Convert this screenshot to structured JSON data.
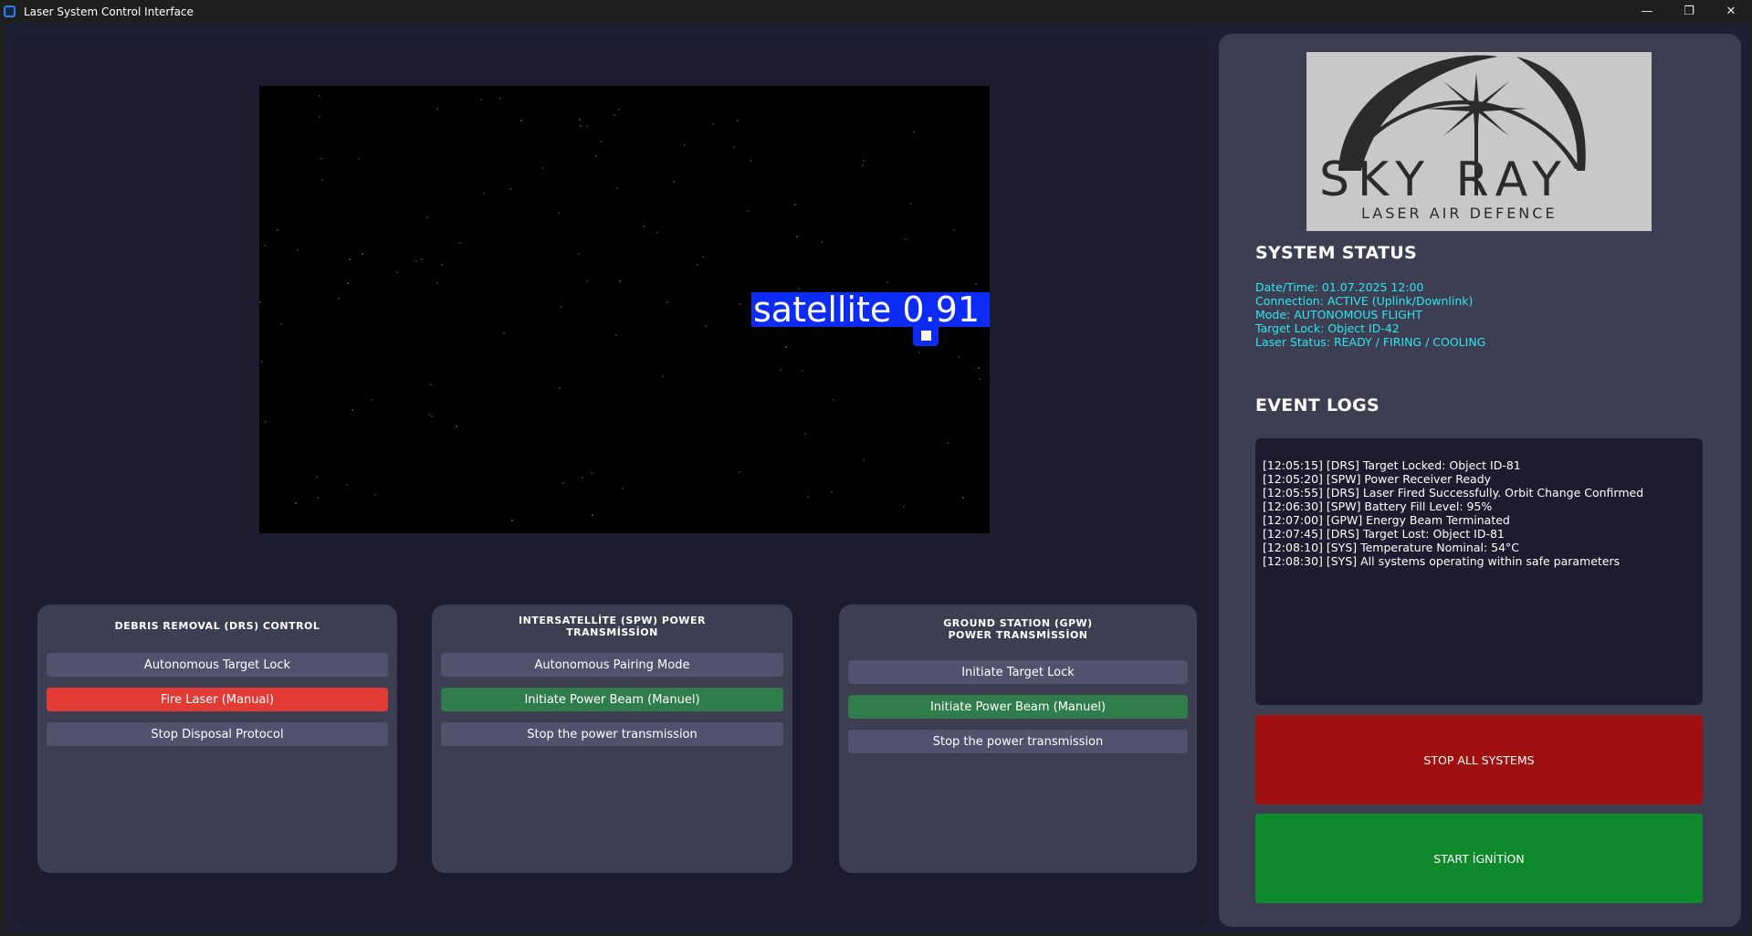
{
  "window": {
    "title": "Laser System Control Interface",
    "controls": {
      "minimize": "—",
      "maximize": "❐",
      "close": "✕"
    }
  },
  "camera": {
    "detection_label": "satellite 0.91"
  },
  "panels": [
    {
      "title": "DEBRIS REMOVAL (DRS) CONTROL",
      "buttons": [
        "Autonomous Target Lock",
        "Fire Laser (Manual)",
        "Stop Disposal Protocol"
      ]
    },
    {
      "title_line1": "INTERSATELLİTE (SPW) POWER",
      "title_line2": "TRANSMİSSİON",
      "buttons": [
        "Autonomous Pairing Mode",
        "Initiate Power Beam (Manuel)",
        "Stop the power transmission"
      ]
    },
    {
      "title_line1": "GROUND STATION (GPW)",
      "title_line2": "POWER TRANSMİSSİON",
      "buttons": [
        "Initiate Target Lock",
        "Initiate Power Beam (Manuel)",
        "Stop the power transmission"
      ]
    }
  ],
  "logo": {
    "brand": "SKY RAY",
    "tagline": "LASER AIR DEFENCE"
  },
  "system_status": {
    "title": "SYSTEM STATUS",
    "lines": [
      "Date/Time: 01.07.2025 12:00",
      "Connection: ACTIVE (Uplink/Downlink)",
      "Mode: AUTONOMOUS FLIGHT",
      "Target Lock: Object ID-42",
      "Laser Status: READY / FIRING / COOLING"
    ]
  },
  "event_logs": {
    "title": "EVENT LOGS",
    "entries": [
      "[12:05:15] [DRS] Target Locked: Object ID-81",
      "[12:05:20] [SPW] Power Receiver Ready",
      "[12:05:55] [DRS] Laser Fired Successfully. Orbit Change Confirmed",
      "[12:06:30] [SPW] Battery Fill Level: 95%",
      "[12:07:00] [GPW] Energy Beam Terminated",
      "[12:07:45] [DRS] Target Lost: Object ID-81",
      "[12:08:10] [SYS] Temperature Nominal: 54°C",
      "[12:08:30] [SYS] All systems operating within safe parameters"
    ]
  },
  "actions": {
    "stop_all": "STOP ALL SYSTEMS",
    "start_ignition": "START İGNİTİON"
  },
  "colors": {
    "accent_cyan": "#2de6f0",
    "fire_red": "#e23a35",
    "beam_green": "#2e7d4a",
    "stop_red": "#a01010",
    "start_green": "#0e8a2d",
    "detection_blue": "#0c2cf5"
  }
}
